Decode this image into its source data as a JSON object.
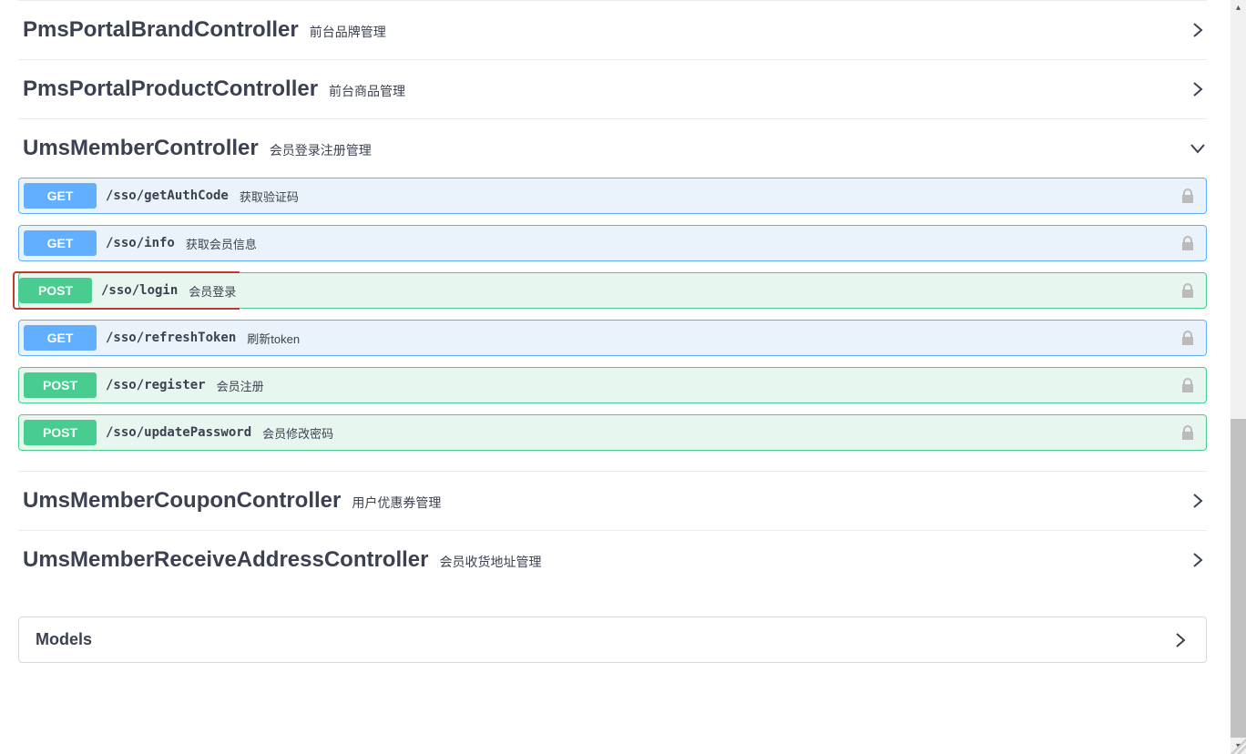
{
  "tags": [
    {
      "name": "PmsPortalBrandController",
      "desc": "前台品牌管理",
      "expanded": false,
      "ops": []
    },
    {
      "name": "PmsPortalProductController",
      "desc": "前台商品管理",
      "expanded": false,
      "ops": []
    },
    {
      "name": "UmsMemberController",
      "desc": "会员登录注册管理",
      "expanded": true,
      "ops": [
        {
          "method": "GET",
          "path": "/sso/getAuthCode",
          "summary": "获取验证码",
          "highlighted": false
        },
        {
          "method": "GET",
          "path": "/sso/info",
          "summary": "获取会员信息",
          "highlighted": false
        },
        {
          "method": "POST",
          "path": "/sso/login",
          "summary": "会员登录",
          "highlighted": true
        },
        {
          "method": "GET",
          "path": "/sso/refreshToken",
          "summary": "刷新token",
          "highlighted": false
        },
        {
          "method": "POST",
          "path": "/sso/register",
          "summary": "会员注册",
          "highlighted": false
        },
        {
          "method": "POST",
          "path": "/sso/updatePassword",
          "summary": "会员修改密码",
          "highlighted": false
        }
      ]
    },
    {
      "name": "UmsMemberCouponController",
      "desc": "用户优惠券管理",
      "expanded": false,
      "ops": []
    },
    {
      "name": "UmsMemberReceiveAddressController",
      "desc": "会员收货地址管理",
      "expanded": false,
      "ops": []
    }
  ],
  "models_label": "Models"
}
